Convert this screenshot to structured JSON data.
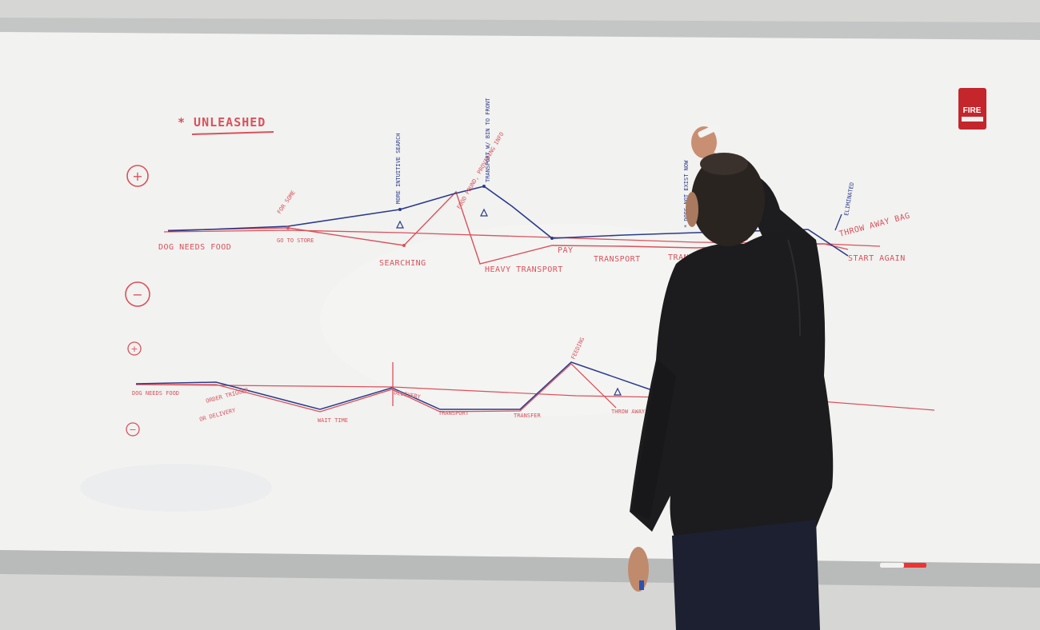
{
  "board": {
    "title": "* UNLEASHED",
    "colors": {
      "red": "#d9525c",
      "blue": "#2b3b8c",
      "board": "#f3f3f1",
      "wall": "#d8d8d5",
      "frame": "#bfc0c0"
    }
  },
  "top_map": {
    "plus_marker": "+",
    "minus_marker": "−",
    "labels": {
      "dog_needs_food": "DOG NEEDS FOOD",
      "for_some": "FOR SOME",
      "go_to_store": "GO TO STORE",
      "searching": "SEARCHING",
      "more_intuitive_search": "MORE INTUITIVE SEARCH",
      "food_found": "FOOD FOUND, PROVIDING INFO",
      "transport_bin": "TRANSPORT W/ BIN TO FRONT",
      "heavy_transport": "HEAVY TRANSPORT",
      "pay": "PAY",
      "transport": "TRANSPORT",
      "trans_partial": "TRANSP",
      "does_not_exist": "* DOES NOT EXIST NOW",
      "eliminated": "ELIMINATED",
      "throw_away_bag": "THROW AWAY BAG",
      "start_again": "START AGAIN"
    }
  },
  "bottom_map": {
    "plus_marker": "+",
    "minus_marker": "−",
    "labels": {
      "dog_needs_food": "DOG NEEDS FOOD",
      "order_trigger": "ORDER TRIGGER",
      "or_delivery": "OR DELIVERY",
      "wait_time": "WAIT TIME",
      "delivery": "DELIVERY",
      "transport": "TRANSPORT",
      "transfer": "TRANSFER",
      "feeding": "FEEDING",
      "throw_away_bag": "THROW AWAY BAG"
    }
  },
  "fire_alarm": {
    "label": "FIRE"
  }
}
